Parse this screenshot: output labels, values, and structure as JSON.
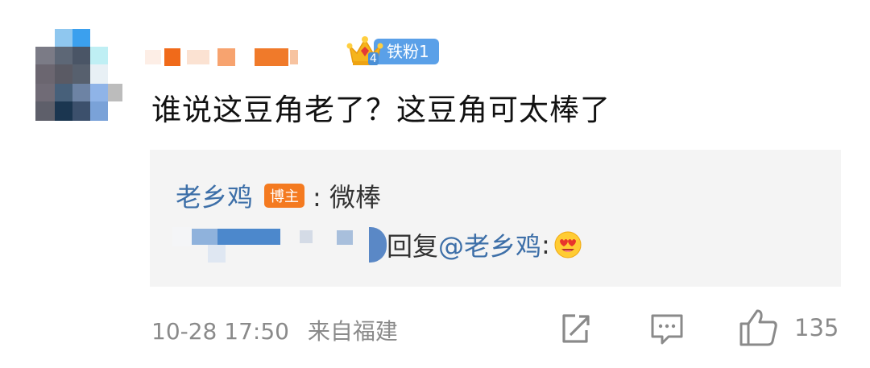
{
  "comment": {
    "fan_badge": {
      "label": "铁粉1",
      "crown_level": "4",
      "icon": "crown-icon"
    },
    "text": "谁说这豆角老了？这豆角可太棒了"
  },
  "reply_box": {
    "reply1": {
      "author": "老乡鸡",
      "author_badge": "博主",
      "text": ": 微棒"
    },
    "reply2": {
      "prefix": "回复",
      "mention": "@老乡鸡",
      "colon": ":",
      "emoji": "heart-eyes-emoji"
    }
  },
  "footer": {
    "timestamp": "10-28 17:50",
    "location": "来自福建",
    "icons": [
      "share-icon",
      "comment-icon",
      "like-icon"
    ],
    "like_count": "135"
  },
  "colors": {
    "link": "#3d6fa8",
    "fan_badge": "#5aa0e8",
    "blogger_badge": "#f47a20",
    "reply_bg": "#f4f4f4",
    "meta": "#8a8a8a"
  }
}
